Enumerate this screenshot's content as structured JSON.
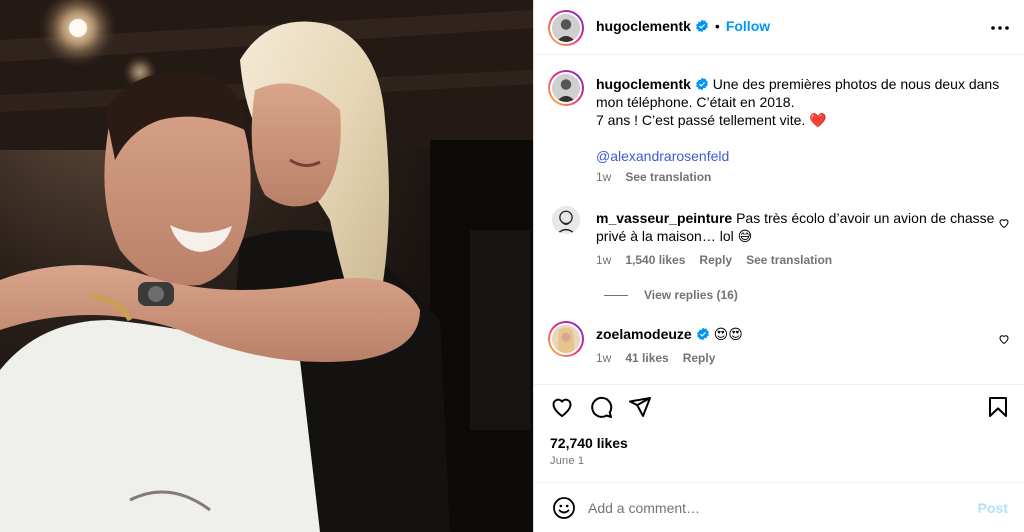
{
  "post": {
    "author": "hugoclementk",
    "follow_label": "Follow",
    "separator": "•",
    "caption_line1": "Une des premières photos de nous deux dans",
    "caption_line2": "mon téléphone. C’était en 2018.",
    "caption_line3": "7 ans ! C’est passé tellement vite.",
    "caption_emoji": "❤️",
    "mention": "@alexandrarosenfeld",
    "time": "1w",
    "see_translation": "See translation",
    "likes": "72,740 likes",
    "date": "June 1"
  },
  "comments": [
    {
      "username": "m_vasseur_peinture",
      "text_line1": "Pas très écolo d’avoir un avion de chasse",
      "text_line2": "privé à la maison… lol 😅",
      "time": "1w",
      "likes": "1,540 likes",
      "reply": "Reply",
      "see_translation": "See translation",
      "view_replies": "View replies (16)"
    },
    {
      "username": "zoelamodeuze",
      "text": "😍😍",
      "time": "1w",
      "likes": "41 likes",
      "reply": "Reply"
    }
  ],
  "composer": {
    "placeholder": "Add a comment…",
    "post_label": "Post"
  },
  "icons": {
    "like": "heart-icon",
    "comment": "comment-icon",
    "share": "paper-plane-icon",
    "save": "bookmark-icon",
    "emoji": "emoji-icon",
    "more": "more-horizontal-icon",
    "verified": "verified-badge-icon"
  },
  "colors": {
    "accent": "#0095f6",
    "mention": "#3c5ad6",
    "muted": "#737373",
    "verified": "#0095f6",
    "post_disabled": "#b2dffc"
  }
}
